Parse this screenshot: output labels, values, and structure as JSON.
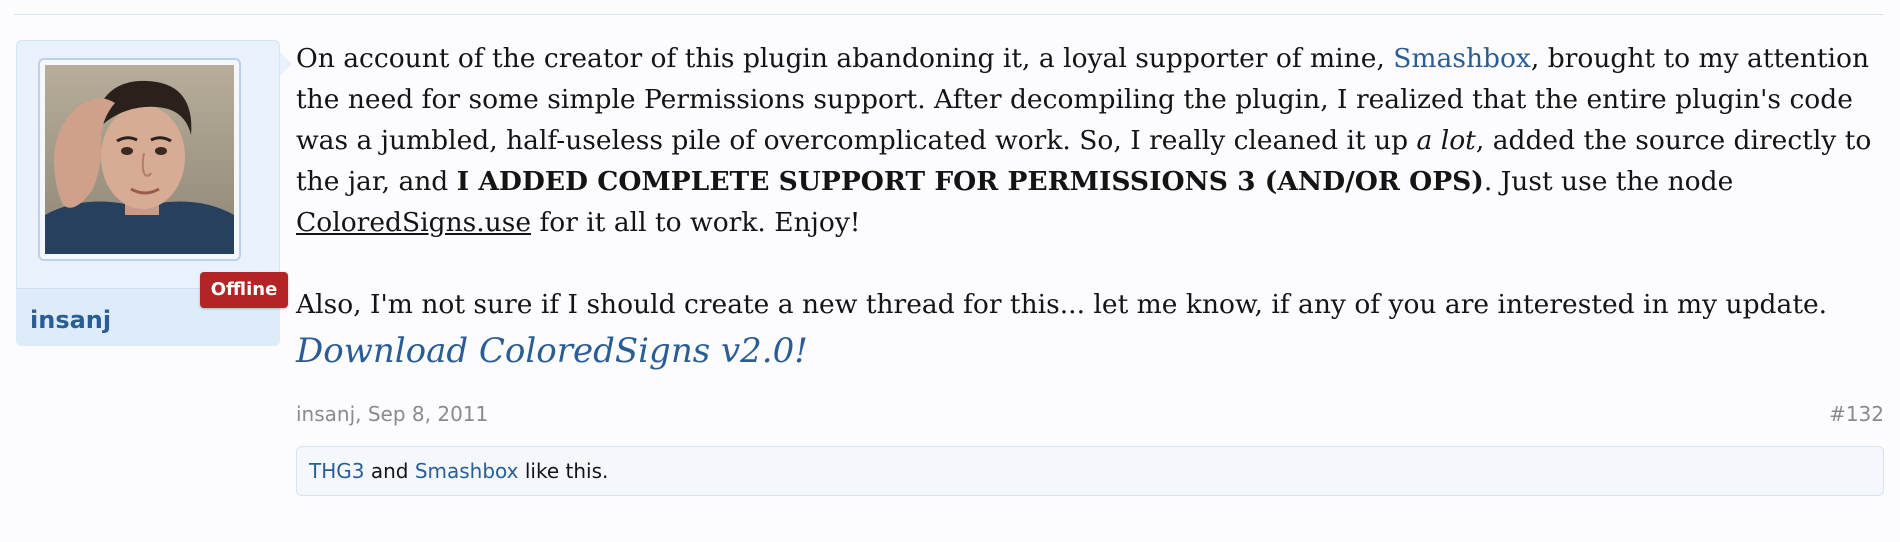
{
  "post": {
    "author": {
      "username": "insanj",
      "status_badge": "Offline",
      "avatar_alt": "insanj"
    },
    "message": {
      "p1_a": "On account of the creator of this plugin abandoning it, a loyal supporter of mine, ",
      "p1_link": "Smashbox",
      "p1_b": ", brought to my attention the need for some simple Permissions support. After decompiling the plugin, I realized that the entire plugin's code was a jumbled, half-useless pile of overcomplicated work. So, I really cleaned it up ",
      "p1_em": "a lot",
      "p1_c": ", added the source directly to the jar, and ",
      "p1_strong": "I ADDED COMPLETE SUPPORT FOR PERMISSIONS 3 (AND/OR OPS)",
      "p1_d": ". Just use the node ",
      "p1_node": "ColoredSigns.use",
      "p1_e": " for it all to work. Enjoy!",
      "p2": "Also, I'm not sure if I should create a new thread for this... let me know, if any of you are interested in my update.",
      "download_link": "Download ColoredSigns v2.0!"
    },
    "meta": {
      "author_date": "insanj, Sep 8, 2011",
      "post_number": "#132"
    },
    "likes": {
      "user1": "THG3",
      "conjunction": " and ",
      "user2": "Smashbox",
      "suffix": " like this."
    }
  }
}
